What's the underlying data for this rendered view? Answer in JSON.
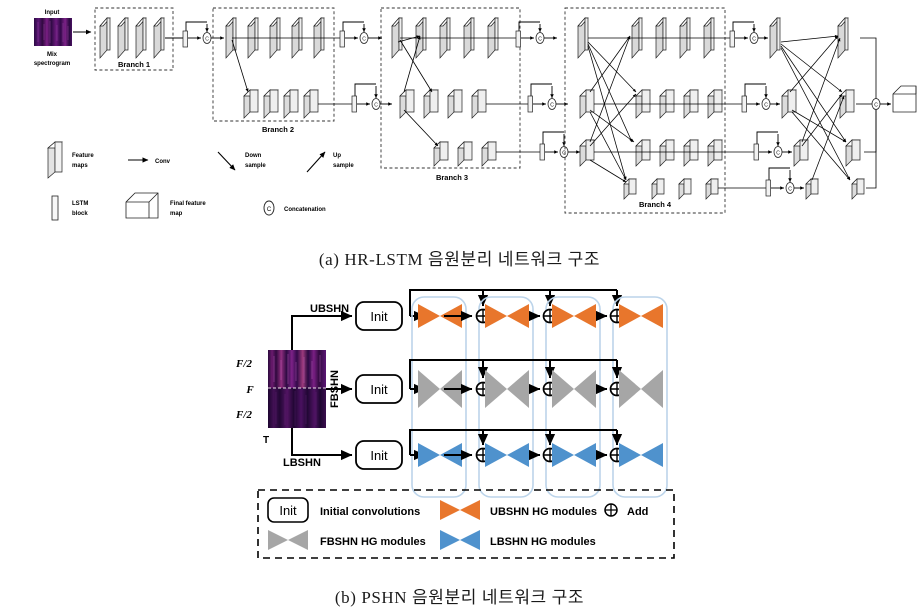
{
  "figure_a": {
    "caption": "(a) HR-LSTM 음원분리 네트워크 구조",
    "input": {
      "title": "Input",
      "line1": "Mix",
      "line2": "spectrogram"
    },
    "branches": [
      {
        "label": "Branch 1",
        "rows": 1,
        "blocks_per_row": [
          4
        ]
      },
      {
        "label": "Branch 2",
        "rows": 2,
        "blocks_per_row": [
          5,
          4
        ]
      },
      {
        "label": "Branch 3",
        "rows": 3,
        "blocks_per_row": [
          5,
          4,
          3
        ]
      },
      {
        "label": "Branch 4",
        "rows": 4,
        "blocks_per_row": [
          5,
          4,
          4,
          4
        ]
      }
    ],
    "legend": [
      {
        "icon": "feature-maps-icon",
        "line1": "Feature",
        "line2": "maps"
      },
      {
        "icon": "conv-arrow-icon",
        "line1": "Conv",
        "line2": ""
      },
      {
        "icon": "down-sample-arrow-icon",
        "line1": "Down",
        "line2": "sample"
      },
      {
        "icon": "up-sample-arrow-icon",
        "line1": "Up",
        "line2": "sample"
      },
      {
        "icon": "lstm-block-icon",
        "line1": "LSTM",
        "line2": "block"
      },
      {
        "icon": "final-feature-map-icon",
        "line1": "Final feature",
        "line2": "map"
      },
      {
        "icon": "concatenation-icon",
        "line1": "Concatenation",
        "line2": ""
      }
    ],
    "node_symbols": {
      "concat": "C",
      "lstm": "LSTM"
    }
  },
  "figure_b": {
    "caption": "(b) PSHN 음원분리 네트워크 구조",
    "spectrogram_axis": {
      "top": "F/2",
      "middle": "F",
      "bottom": "F/2",
      "time": "T",
      "numerator_top": "F",
      "denominator_top": "2",
      "numerator_bottom": "F",
      "denominator_bottom": "2"
    },
    "streams": [
      {
        "name": "UBSHN",
        "init_label": "Init",
        "color": "#E8762C",
        "modules": 4
      },
      {
        "name": "FBSHN",
        "init_label": "Init",
        "color": "#A6A6A6",
        "modules": 4
      },
      {
        "name": "LBSHN",
        "init_label": "Init",
        "color": "#4F92CD",
        "modules": 4
      }
    ],
    "add_symbol": "⊕",
    "legend": [
      {
        "icon": "init-box-icon",
        "label": "Initial convolutions"
      },
      {
        "icon": "ubshn-hg-icon",
        "label": "UBSHN HG modules"
      },
      {
        "icon": "add-icon",
        "label": "Add"
      },
      {
        "icon": "fbshn-hg-icon",
        "label": "FBSHN HG modules"
      },
      {
        "icon": "lbshn-hg-icon",
        "label": "LBSHN HG modules"
      }
    ],
    "colors": {
      "ubshn": "#E8762C",
      "fbshn": "#A6A6A6",
      "lbshn": "#4F92CD",
      "container_border": "#BCD4EA",
      "line": "#000000"
    }
  }
}
